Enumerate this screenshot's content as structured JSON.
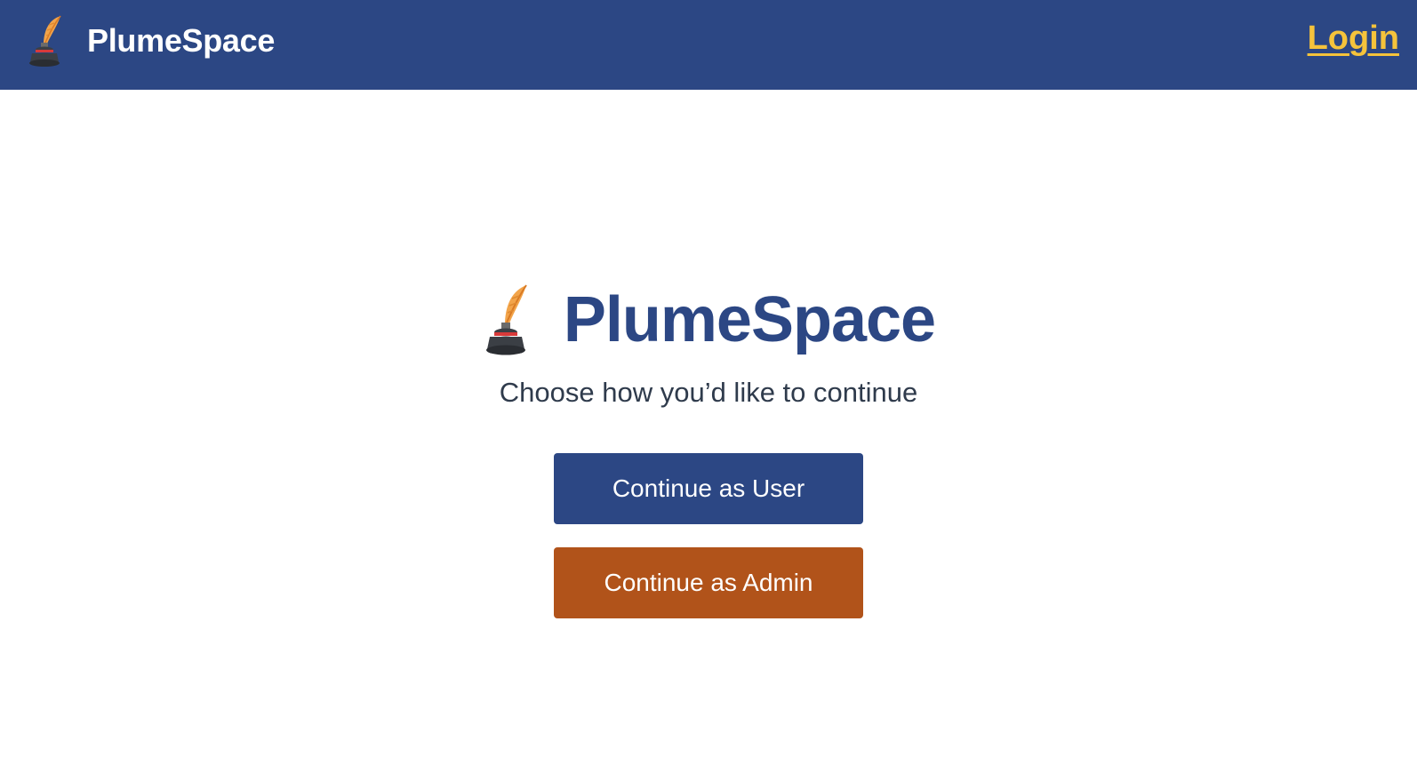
{
  "header": {
    "brand_name": "PlumeSpace",
    "brand_icon": "quill-inkwell-icon",
    "login_label": "Login",
    "background_color": "#2c4784",
    "login_color": "#f5c33b"
  },
  "hero": {
    "icon": "quill-inkwell-icon",
    "title": "PlumeSpace",
    "subtitle": "Choose how you’d like to continue",
    "title_color": "#2c4784"
  },
  "actions": {
    "user_label": "Continue as User",
    "admin_label": "Continue as Admin",
    "user_color": "#2c4784",
    "admin_color": "#b1531a"
  }
}
